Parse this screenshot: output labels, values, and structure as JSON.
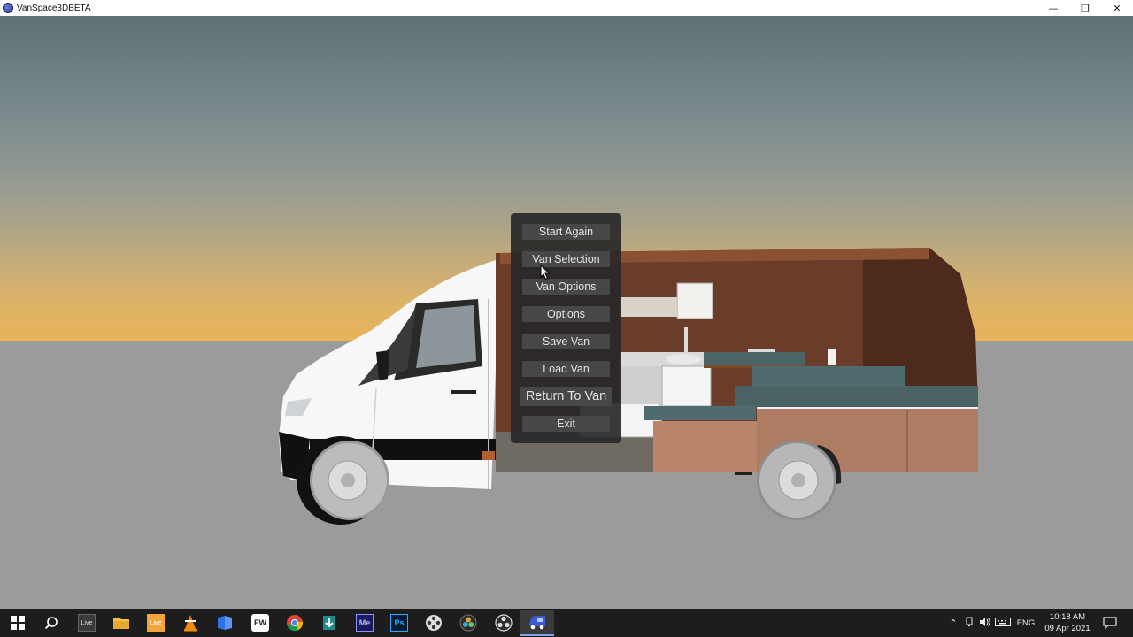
{
  "window": {
    "title": "VanSpace3DBETA",
    "minimize_glyph": "—",
    "restore_glyph": "❐",
    "close_glyph": "✕"
  },
  "menu": {
    "items": [
      {
        "label": "Start Again"
      },
      {
        "label": "Van Selection"
      },
      {
        "label": "Van Options"
      },
      {
        "label": "Options"
      },
      {
        "label": "Save Van"
      },
      {
        "label": "Load Van"
      },
      {
        "label": "Return To Van"
      },
      {
        "label": "Exit"
      }
    ]
  },
  "taskbar": {
    "apps": [
      {
        "name": "start",
        "icon": "windows-logo-icon"
      },
      {
        "name": "search",
        "icon": "search-icon"
      },
      {
        "name": "live",
        "icon": "live-icon",
        "label": "Live"
      },
      {
        "name": "file-explorer",
        "icon": "folder-icon"
      },
      {
        "name": "live2",
        "icon": "live-orange-icon",
        "label": "Live"
      },
      {
        "name": "vlc",
        "icon": "vlc-cone-icon"
      },
      {
        "name": "app-blue",
        "icon": "blue-app-icon"
      },
      {
        "name": "fw",
        "icon": "fw-icon",
        "label": "FW"
      },
      {
        "name": "chrome",
        "icon": "chrome-icon"
      },
      {
        "name": "installer",
        "icon": "installer-icon"
      },
      {
        "name": "media-encoder",
        "icon": "media-encoder-icon",
        "label": "Me"
      },
      {
        "name": "photoshop",
        "icon": "photoshop-icon",
        "label": "Ps"
      },
      {
        "name": "video-app",
        "icon": "film-reel-icon"
      },
      {
        "name": "resolve",
        "icon": "resolve-icon"
      },
      {
        "name": "obs",
        "icon": "obs-icon"
      },
      {
        "name": "vanspace",
        "icon": "vanspace-icon"
      }
    ],
    "language": "ENG",
    "time": "10:18 AM",
    "date": "09 Apr 2021"
  },
  "colors": {
    "menu_bg": "#282828",
    "menu_button": "#474747",
    "menu_text": "#e4e4e4",
    "taskbar": "#1d1d1d"
  }
}
